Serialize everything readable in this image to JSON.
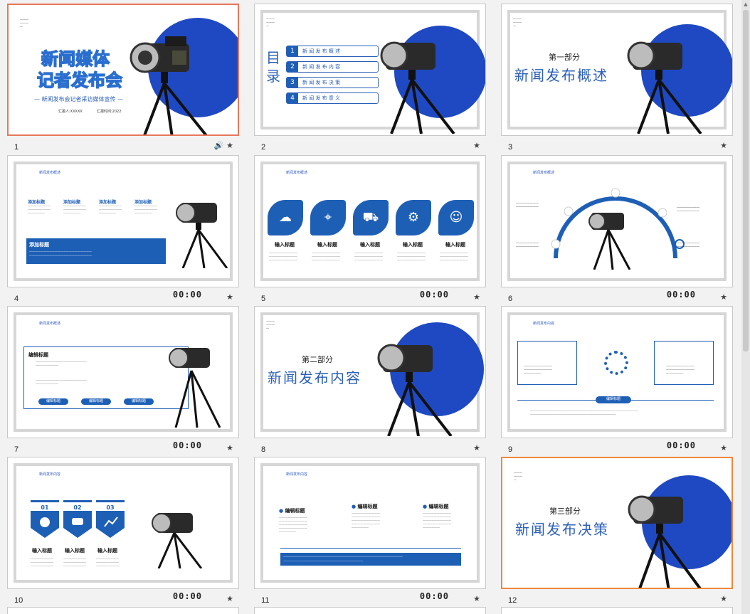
{
  "slides": [
    {
      "num": "1",
      "timer": "",
      "title_line1": "新闻媒体",
      "title_line2": "记者发布会",
      "subtitle": "— 新闻发布会记者采访媒体宣传 —",
      "meta_a": "汇报人:XXXXX",
      "meta_b": "汇报时间:2022"
    },
    {
      "num": "2",
      "timer": "",
      "toc_title": "目录",
      "items": [
        {
          "idx": "1",
          "label": "新 闻 发 布 概 述"
        },
        {
          "idx": "2",
          "label": "新 闻 发 布 内 容"
        },
        {
          "idx": "3",
          "label": "新 闻 发 布 决 策"
        },
        {
          "idx": "4",
          "label": "新 闻 发 布 意 义"
        }
      ]
    },
    {
      "num": "3",
      "timer": "",
      "part": "第一部分",
      "title": "新闻发布概述"
    },
    {
      "num": "4",
      "timer": "00:00",
      "header": "新闻发布概述",
      "col_title": "添加标题",
      "box_title": "添加标题"
    },
    {
      "num": "5",
      "timer": "00:00",
      "header": "新闻发布概述",
      "caption": "输入标题"
    },
    {
      "num": "6",
      "timer": "00:00",
      "header": "新闻发布概述"
    },
    {
      "num": "7",
      "timer": "00:00",
      "header": "新闻发布概述",
      "box_title": "编辑标题",
      "pill": "编辑标题"
    },
    {
      "num": "8",
      "timer": "",
      "part": "第二部分",
      "title": "新闻发布内容"
    },
    {
      "num": "9",
      "timer": "00:00",
      "header": "新闻发布内容",
      "pill": "编辑标题"
    },
    {
      "num": "10",
      "timer": "00:00",
      "header": "新闻发布内容",
      "tabs": [
        "01",
        "02",
        "03"
      ],
      "caption": "输入标题"
    },
    {
      "num": "11",
      "timer": "00:00",
      "header": "新闻发布内容",
      "head": "编辑标题"
    },
    {
      "num": "12",
      "timer": "",
      "part": "第三部分",
      "title": "新闻发布决策"
    }
  ],
  "icons": {
    "star": "★",
    "speaker": "🔊"
  },
  "colors": {
    "accent": "#1f49c2",
    "text_blue": "#2b5fb8",
    "selected": "#e8765a"
  }
}
